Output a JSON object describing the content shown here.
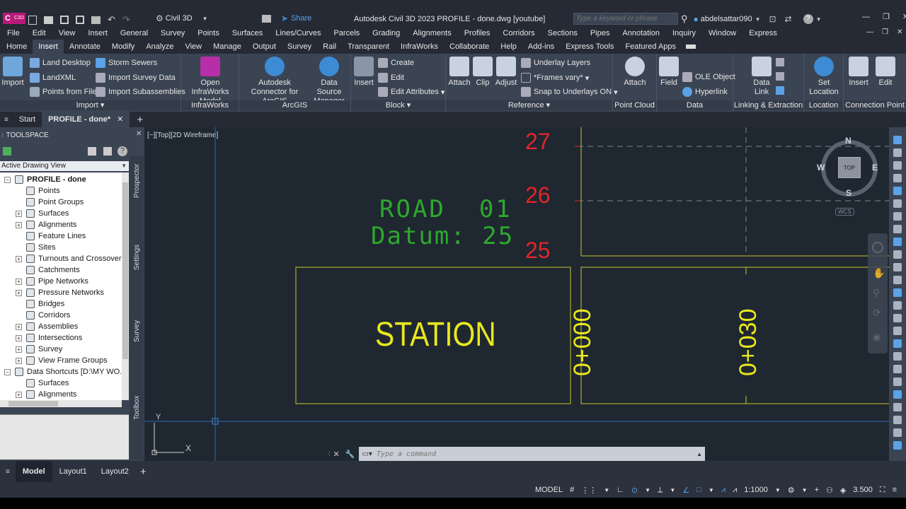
{
  "app": {
    "window_title": "Autodesk Civil 3D 2023   PROFILE - done.dwg [youtube]",
    "workspace": "Civil 3D",
    "share_label": "Share",
    "search_placeholder": "Type a keyword or phrase",
    "user": "abdelsattar090",
    "logo": "C"
  },
  "menu": [
    "File",
    "Edit",
    "View",
    "Insert",
    "General",
    "Survey",
    "Points",
    "Surfaces",
    "Lines/Curves",
    "Parcels",
    "Grading",
    "Alignments",
    "Profiles",
    "Corridors",
    "Sections",
    "Pipes",
    "Annotation",
    "Inquiry",
    "Window",
    "Express"
  ],
  "ribbon_tabs": [
    "Home",
    "Insert",
    "Annotate",
    "Modify",
    "Analyze",
    "View",
    "Manage",
    "Output",
    "Survey",
    "Rail",
    "Transparent",
    "InfraWorks",
    "Collaborate",
    "Help",
    "Add-ins",
    "Express Tools",
    "Featured Apps"
  ],
  "active_ribbon_tab": "Insert",
  "ribbon": {
    "import": {
      "title": "Import",
      "big": "Import",
      "small": [
        "Land Desktop",
        "LandXML",
        "Points from File",
        "Storm Sewers",
        "Import Survey Data",
        "Import Subassemblies"
      ]
    },
    "infraworks": {
      "title": "InfraWorks",
      "big": "Open InfraWorks Model"
    },
    "arcgis": {
      "title": "ArcGIS",
      "big1": "Autodesk Connector for ArcGIS",
      "big2": "Data Source Manager"
    },
    "block": {
      "title": "Block",
      "big": "Insert",
      "small": [
        "Create",
        "Edit",
        "Edit Attributes"
      ]
    },
    "reference": {
      "title": "Reference",
      "big": [
        "Attach",
        "Clip",
        "Adjust"
      ],
      "small": [
        "Underlay Layers",
        "*Frames vary*",
        "Snap to Underlays ON"
      ]
    },
    "pointcloud": {
      "title": "Point Cloud",
      "big": "Attach"
    },
    "data": {
      "title": "Data",
      "big": "Field",
      "small": [
        "OLE Object",
        "Hyperlink"
      ]
    },
    "linking": {
      "title": "Linking & Extraction",
      "big": "Data Link"
    },
    "location": {
      "title": "Location",
      "big": "Set Location"
    },
    "connection": {
      "title": "Connection Point",
      "big": [
        "Insert",
        "Edit"
      ]
    }
  },
  "doc_tabs": [
    "Start",
    "PROFILE - done*"
  ],
  "toolspace": {
    "title": "TOOLSPACE",
    "view_select": "Active Drawing View",
    "vertical_tabs": [
      "Prospector",
      "Settings",
      "Survey",
      "Toolbox"
    ],
    "tree": [
      {
        "label": "PROFILE - done",
        "level": 0,
        "bold": true,
        "exp": "−"
      },
      {
        "label": "Points",
        "level": 1,
        "exp": ""
      },
      {
        "label": "Point Groups",
        "level": 1,
        "exp": ""
      },
      {
        "label": "Surfaces",
        "level": 1,
        "exp": "+"
      },
      {
        "label": "Alignments",
        "level": 1,
        "exp": "+"
      },
      {
        "label": "Feature Lines",
        "level": 1,
        "exp": ""
      },
      {
        "label": "Sites",
        "level": 1,
        "exp": ""
      },
      {
        "label": "Turnouts and Crossovers",
        "level": 1,
        "exp": "+"
      },
      {
        "label": "Catchments",
        "level": 1,
        "exp": ""
      },
      {
        "label": "Pipe Networks",
        "level": 1,
        "exp": "+"
      },
      {
        "label": "Pressure Networks",
        "level": 1,
        "exp": "+"
      },
      {
        "label": "Bridges",
        "level": 1,
        "exp": ""
      },
      {
        "label": "Corridors",
        "level": 1,
        "exp": ""
      },
      {
        "label": "Assemblies",
        "level": 1,
        "exp": "+"
      },
      {
        "label": "Intersections",
        "level": 1,
        "exp": "+"
      },
      {
        "label": "Survey",
        "level": 1,
        "exp": "+"
      },
      {
        "label": "View Frame Groups",
        "level": 1,
        "exp": "+"
      },
      {
        "label": "Data Shortcuts [D:\\MY WO...",
        "level": 0,
        "exp": "−"
      },
      {
        "label": "Surfaces",
        "level": 1,
        "exp": ""
      },
      {
        "label": "Alignments",
        "level": 1,
        "exp": "+"
      }
    ]
  },
  "viewport": {
    "label": "[−][Top][2D Wireframe]",
    "road_name": "ROAD  01",
    "datum": "Datum: 25",
    "station_title": "STATION",
    "elevations": [
      "27",
      "26",
      "25"
    ],
    "stations": [
      "0+000",
      "0+030"
    ],
    "command_placeholder": "Type a command",
    "viewcube": {
      "top": "TOP",
      "n": "N",
      "s": "S",
      "e": "E",
      "w": "W",
      "wcs": "WCS"
    },
    "ucs_x": "X",
    "ucs_y": "Y"
  },
  "layout_tabs": [
    "Model",
    "Layout1",
    "Layout2"
  ],
  "status": {
    "model": "MODEL",
    "scale": "1:1000",
    "value": "3.500"
  },
  "colors": {
    "accent": "#3d8bd4",
    "cad_red": "#e0262a",
    "cad_yellow": "#e8e81e",
    "cad_green": "#2ea82e",
    "grid_line": "#3067b5"
  }
}
